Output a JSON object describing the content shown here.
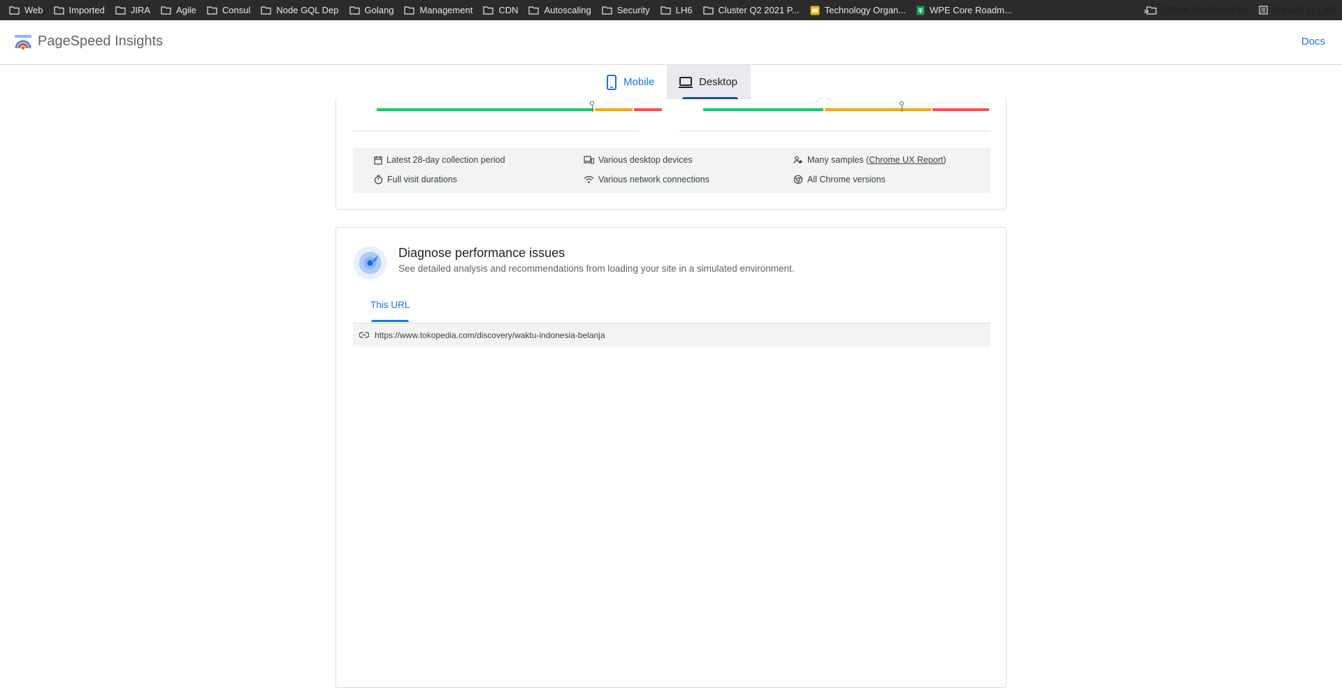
{
  "bookmarks": {
    "items": [
      {
        "label": "Web",
        "icon": "folder-icon"
      },
      {
        "label": "Imported",
        "icon": "folder-icon"
      },
      {
        "label": "JIRA",
        "icon": "folder-icon"
      },
      {
        "label": "Agile",
        "icon": "folder-icon"
      },
      {
        "label": "Consul",
        "icon": "folder-icon"
      },
      {
        "label": "Node GQL Dep",
        "icon": "folder-icon"
      },
      {
        "label": "Golang",
        "icon": "folder-icon"
      },
      {
        "label": "Management",
        "icon": "folder-icon"
      },
      {
        "label": "CDN",
        "icon": "folder-icon"
      },
      {
        "label": "Autoscaling",
        "icon": "folder-icon"
      },
      {
        "label": "Security",
        "icon": "folder-icon"
      },
      {
        "label": "LH6",
        "icon": "folder-icon"
      },
      {
        "label": "Cluster Q2 2021 P...",
        "icon": "folder-icon"
      },
      {
        "label": "Technology Organ...",
        "icon": "slides-icon"
      },
      {
        "label": "WPE Core Roadm...",
        "icon": "sheets-icon"
      }
    ],
    "overflow": "»",
    "other": "Other Bookmarks",
    "reading_list": "Reading List"
  },
  "header": {
    "title": "PageSpeed Insights",
    "docs": "Docs"
  },
  "device_tabs": {
    "mobile": "Mobile",
    "desktop": "Desktop",
    "selected": "Desktop"
  },
  "field_data": {
    "distributions": [
      {
        "good": 0.745,
        "ni": 0.135,
        "poor": 0.1,
        "marker": 0.75
      },
      {
        "good": 0.39,
        "ni": 0.345,
        "poor": 0.185,
        "marker": 0.69
      }
    ],
    "meta": {
      "period": "Latest 28-day collection period",
      "devices": "Various desktop devices",
      "samples_prefix": "Many samples (",
      "samples_link": "Chrome UX Report",
      "samples_suffix": ")",
      "durations": "Full visit durations",
      "network": "Various network connections",
      "chrome": "All Chrome versions"
    },
    "colors": {
      "good": "#0cce6b",
      "ni": "#ffa400",
      "poor": "#ff4e42"
    }
  },
  "diagnose": {
    "title": "Diagnose performance issues",
    "subtitle": "See detailed analysis and recommendations from loading your site in a simulated environment.",
    "tab": "This URL",
    "url": "https://www.tokopedia.com/discovery/waktu-indonesia-belanja"
  }
}
